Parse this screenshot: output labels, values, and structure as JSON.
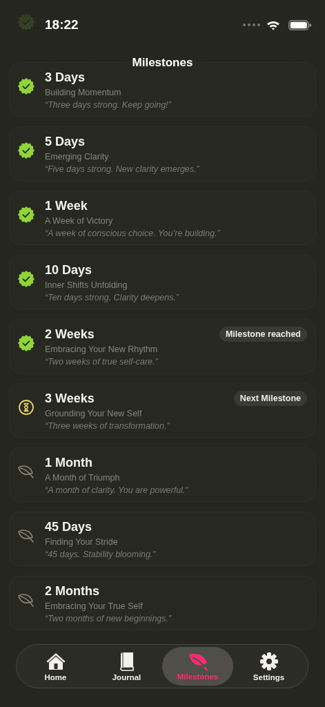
{
  "status_bar": {
    "time": "18:22"
  },
  "header": {
    "title": "Milestones"
  },
  "milestones": [
    {
      "kind": "reached"
    },
    {
      "title": "3 Days",
      "subtitle": "Building Momentum",
      "quote": "“Three days strong. Keep going!”",
      "kind": "reached"
    },
    {
      "title": "5 Days",
      "subtitle": "Emerging Clarity",
      "quote": "“Five days strong. New clarity emerges.”",
      "kind": "reached"
    },
    {
      "title": "1 Week",
      "subtitle": "A Week of Victory",
      "quote": "“A week of conscious choice. You’re building.”",
      "kind": "reached"
    },
    {
      "title": "10 Days",
      "subtitle": "Inner Shifts Unfolding",
      "quote": "“Ten days strong. Clarity deepens.”",
      "kind": "reached"
    },
    {
      "title": "2 Weeks",
      "subtitle": "Embracing Your New Rhythm",
      "quote": "“Two weeks of true self-care.”",
      "kind": "reached",
      "badge": "Milestone reached"
    },
    {
      "title": "3 Weeks",
      "subtitle": "Grounding Your New Self",
      "quote": "“Three weeks of transformation.”",
      "kind": "next",
      "badge": "Next Milestone"
    },
    {
      "title": "1 Month",
      "subtitle": "A Month of Triumph",
      "quote": "“A month of clarity. You are powerful.”",
      "kind": "locked"
    },
    {
      "title": "45 Days",
      "subtitle": "Finding Your Stride",
      "quote": "“45 days. Stability blooming.”",
      "kind": "locked"
    },
    {
      "title": "2 Months",
      "subtitle": "Embracing Your True Self",
      "quote": "“Two months of new beginnings.”",
      "kind": "locked"
    }
  ],
  "tabs": [
    {
      "label": "Home",
      "kind": "home",
      "selected": false
    },
    {
      "label": "Journal",
      "kind": "book",
      "selected": false
    },
    {
      "label": "Milestones",
      "kind": "leaf",
      "selected": true
    },
    {
      "label": "Settings",
      "kind": "gear",
      "selected": false
    }
  ]
}
